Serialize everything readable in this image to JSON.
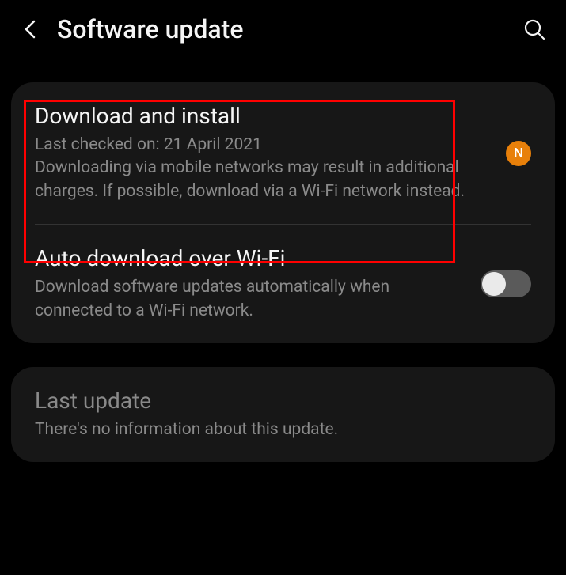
{
  "header": {
    "title": "Software update"
  },
  "card1": {
    "download_install": {
      "title": "Download and install",
      "desc": "Last checked on: 21 April 2021\nDownloading via mobile networks may result in additional charges. If possible, download via a Wi-Fi network instead.",
      "badge": "N"
    },
    "auto_download": {
      "title": "Auto download over Wi-Fi",
      "desc": "Download software updates automatically when connected to a Wi-Fi network.",
      "toggle": false
    }
  },
  "card2": {
    "last_update": {
      "title": "Last update",
      "desc": "There's no information about this update."
    }
  }
}
